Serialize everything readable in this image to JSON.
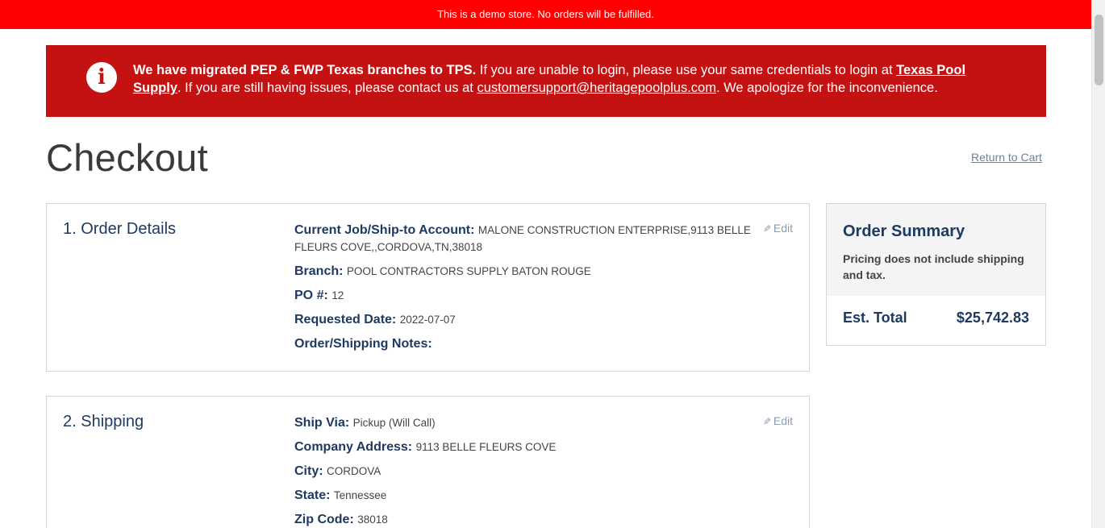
{
  "demo_banner": "This is a demo store. No orders will be fulfilled.",
  "alert": {
    "bold_text": "We have migrated PEP & FWP Texas branches to TPS.",
    "text1": " If you are unable to login, please use your same credentials to login at ",
    "link1": "Texas Pool Supply",
    "text2": ". If you are still having issues, please contact us at ",
    "link2": "customersupport@heritagepoolplus.com",
    "text3": ". We apologize for the inconvenience."
  },
  "page": {
    "title": "Checkout",
    "return_link": "Return to Cart"
  },
  "order_details": {
    "title": "1. Order Details",
    "edit": "Edit",
    "rows": [
      {
        "label": "Current Job/Ship-to Account:",
        "value": "MALONE CONSTRUCTION ENTERPRISE,9113 BELLE FLEURS COVE,,CORDOVA,TN,38018"
      },
      {
        "label": "Branch:",
        "value": "POOL CONTRACTORS SUPPLY BATON ROUGE"
      },
      {
        "label": "PO #:",
        "value": "12"
      },
      {
        "label": "Requested Date:",
        "value": "2022-07-07"
      },
      {
        "label": "Order/Shipping Notes:",
        "value": ""
      }
    ]
  },
  "shipping": {
    "title": "2. Shipping",
    "edit": "Edit",
    "rows": [
      {
        "label": "Ship Via:",
        "value": "Pickup (Will Call)"
      },
      {
        "label": "Company Address:",
        "value": "9113 BELLE FLEURS COVE"
      },
      {
        "label": "City:",
        "value": "CORDOVA"
      },
      {
        "label": "State:",
        "value": "Tennessee"
      },
      {
        "label": "Zip Code:",
        "value": "38018"
      }
    ]
  },
  "summary": {
    "title": "Order Summary",
    "note": "Pricing does not include shipping and tax.",
    "total_label": "Est. Total",
    "total_value": "$25,742.83"
  },
  "colors": {
    "demo_bar": "#ff0000",
    "alert_bg": "#c41212",
    "heading_blue": "#1f3a60"
  }
}
